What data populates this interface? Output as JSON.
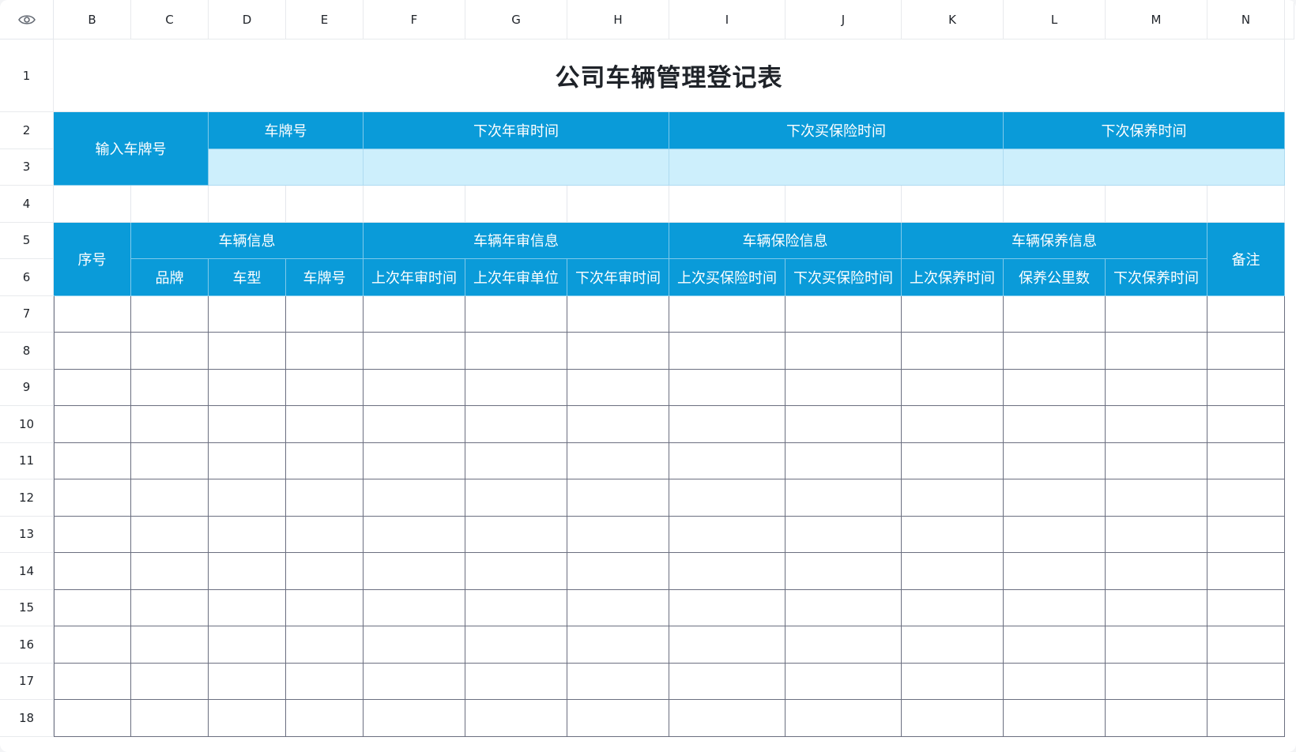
{
  "columns": [
    "B",
    "C",
    "D",
    "E",
    "F",
    "G",
    "H",
    "I",
    "J",
    "K",
    "L",
    "M",
    "N"
  ],
  "rows": [
    "1",
    "2",
    "3",
    "4",
    "5",
    "6",
    "7",
    "8",
    "9",
    "10",
    "11",
    "12",
    "13",
    "14",
    "15",
    "16",
    "17",
    "18"
  ],
  "sheet": {
    "title": "公司车辆管理登记表",
    "lookup": {
      "label": "输入车牌号",
      "plate": "车牌号",
      "next_inspection": "下次年审时间",
      "next_insurance": "下次买保险时间",
      "next_maintenance": "下次保养时间"
    },
    "table": {
      "seq": "序号",
      "remarks": "备注",
      "groups": {
        "vehicle_info": "车辆信息",
        "inspection_info": "车辆年审信息",
        "insurance_info": "车辆保险信息",
        "maintenance_info": "车辆保养信息"
      },
      "sub": {
        "brand": "品牌",
        "model": "车型",
        "plate": "车牌号",
        "last_inspection": "上次年审时间",
        "last_inspection_unit": "上次年审单位",
        "next_inspection": "下次年审时间",
        "last_insurance": "上次买保险时间",
        "next_insurance": "下次买保险时间",
        "last_maintenance": "上次保养时间",
        "maintenance_km": "保养公里数",
        "next_maintenance": "下次保养时间"
      }
    }
  },
  "colors": {
    "header_blue": "#0a9bd9",
    "input_band": "#cdeffc",
    "border_dark": "#6b6f80"
  },
  "icons": {
    "corner": "eye-icon"
  }
}
